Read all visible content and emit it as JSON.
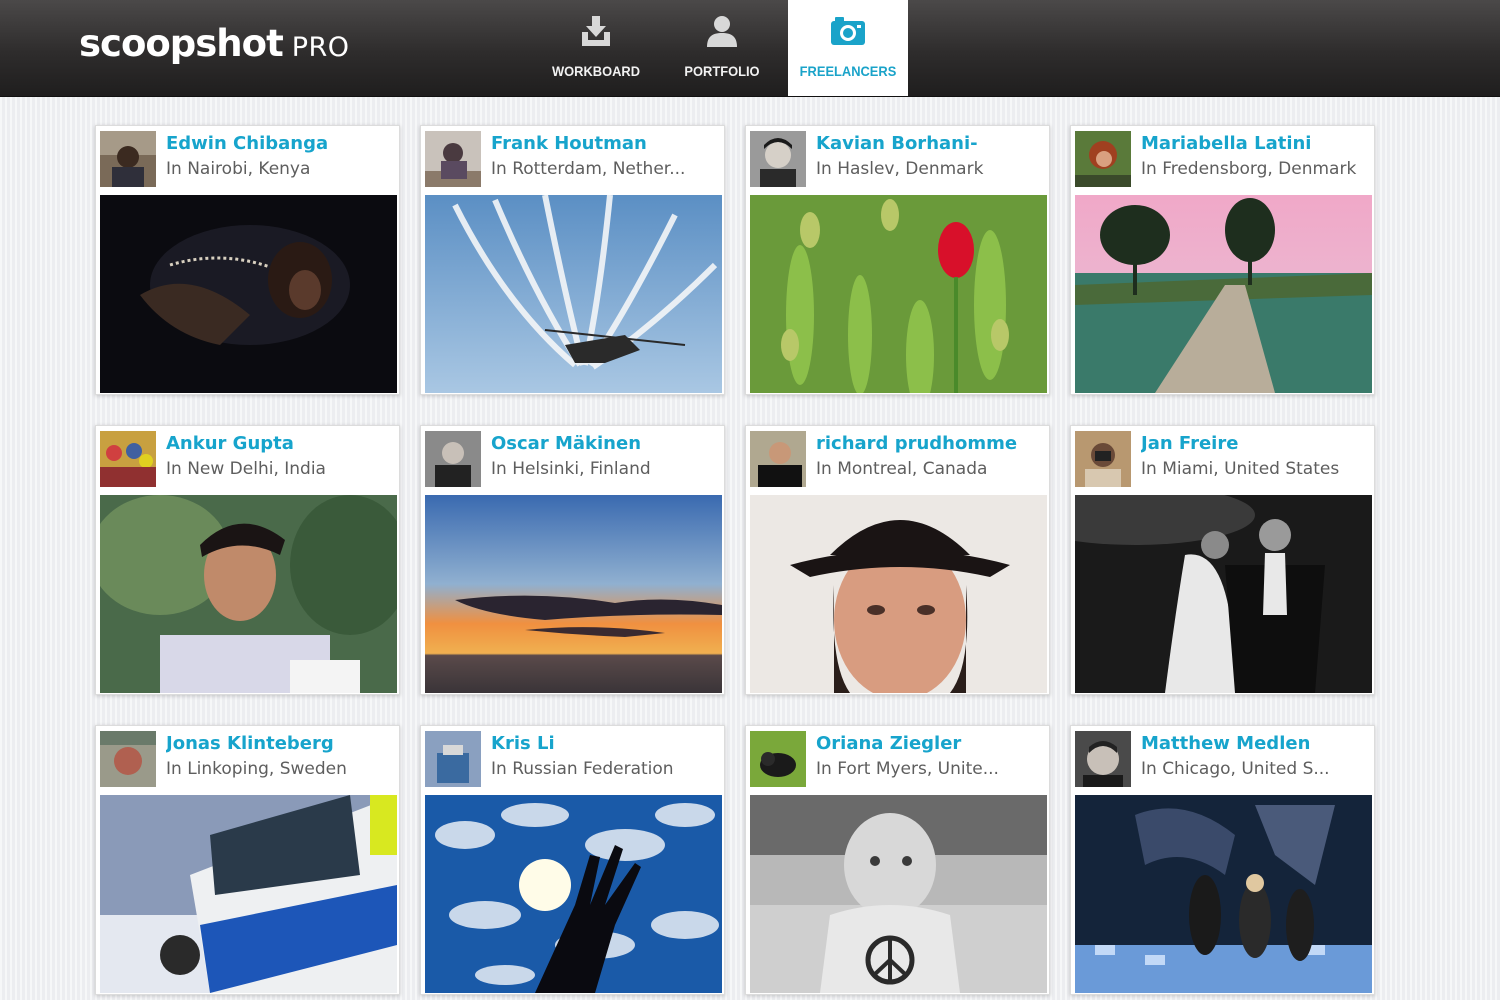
{
  "header": {
    "logo_main": "scoopshot",
    "logo_sub": "PRO",
    "tabs": [
      {
        "label": "WORKBOARD",
        "icon": "download-tray-icon",
        "active": false
      },
      {
        "label": "PORTFOLIO",
        "icon": "person-icon",
        "active": false
      },
      {
        "label": "FREELANCERS",
        "icon": "camera-icon",
        "active": true
      }
    ]
  },
  "colors": {
    "accent": "#1aa3c9",
    "name_text": "#17a4cc",
    "location_text": "#5e5e5e",
    "header_dark": "#2e2c2c"
  },
  "freelancers": [
    {
      "name": "Edwin Chibanga",
      "location": "In Nairobi, Kenya"
    },
    {
      "name": "Frank Houtman",
      "location": "In Rotterdam, Nether..."
    },
    {
      "name": "Kavian Borhani-",
      "location": "In Haslev, Denmark"
    },
    {
      "name": "Mariabella Latini",
      "location": "In Fredensborg, Denmark"
    },
    {
      "name": "Ankur Gupta",
      "location": "In New Delhi, India"
    },
    {
      "name": "Oscar Mäkinen",
      "location": "In Helsinki, Finland"
    },
    {
      "name": "richard prudhomme",
      "location": "In Montreal, Canada"
    },
    {
      "name": "Jan Freire",
      "location": "In Miami, United States"
    },
    {
      "name": "Jonas Klinteberg",
      "location": "In Linkoping, Sweden"
    },
    {
      "name": "Kris Li",
      "location": "In Russian Federation"
    },
    {
      "name": "Oriana Ziegler",
      "location": "In Fort Myers, Unite..."
    },
    {
      "name": "Matthew Medlen",
      "location": "In Chicago, United S..."
    }
  ]
}
